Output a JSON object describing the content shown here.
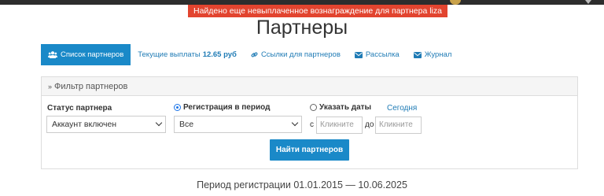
{
  "alert": {
    "text": "Найдено еще невыплаченное вознаграждение для партнера liza"
  },
  "page_title": "Партнеры",
  "tabs": [
    {
      "label": "Список партнеров",
      "icon": "users-icon",
      "active": true
    },
    {
      "label": "Текущие выплаты",
      "value": "12.65 руб",
      "icon": null,
      "active": false
    },
    {
      "label": "Ссылки для партнеров",
      "icon": "link-icon",
      "active": false
    },
    {
      "label": "Рассылка",
      "icon": "envelope-icon",
      "active": false
    },
    {
      "label": "Журнал",
      "icon": "envelope-icon",
      "active": false
    }
  ],
  "filter": {
    "title": "Фильтр партнеров",
    "status_label": "Статус партнера",
    "status_value": "Аккаунт включен",
    "reg_period_label": "Регистрация в период",
    "reg_period_checked": true,
    "reg_period_value": "Все",
    "dates_label": "Указать даты",
    "dates_checked": false,
    "today_link": "Сегодня",
    "from_label": "с",
    "from_placeholder": "Кликните",
    "to_label": "до",
    "to_placeholder": "Кликните",
    "submit_label": "Найти партнеров"
  },
  "period_text": "Период регистрации 01.01.2015 — 10.06.2025",
  "colors": {
    "accent": "#1a89c8",
    "alert": "#e2442f",
    "link": "#1f7bb5"
  }
}
